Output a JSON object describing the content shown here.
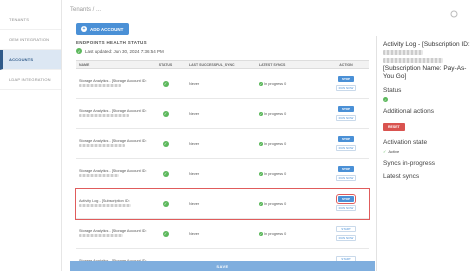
{
  "sidebar": {
    "items": [
      {
        "label": "TENANTS"
      },
      {
        "label": "OEM INTEGRATION"
      },
      {
        "label": "ACCOUNTS"
      },
      {
        "label": "LDAP INTEGRATION"
      }
    ]
  },
  "crumb": "Tenants / ...",
  "toolbar": {
    "add_account_label": "ADD ACCOUNT"
  },
  "health": {
    "title": "ENDPOINTS HEALTH STATUS",
    "last_updated": "Last updated: Jun 30, 2024 7:36:54 PM"
  },
  "table": {
    "headers": {
      "name": "NAME",
      "status": "STATUS",
      "last_sync": "LAST SUCCESSFUL_SYNC",
      "latest_syncs": "LATEST SYNCS",
      "action": "ACTION"
    },
    "rows": [
      {
        "name": "Storage Analytics - [Storage Account ID:",
        "last": "Never",
        "latest": "In progress 0",
        "stop": "STOP",
        "run": "RUN NOW"
      },
      {
        "name": "Storage Analytics - [Storage Account ID:",
        "last": "Never",
        "latest": "In progress 0",
        "stop": "STOP",
        "run": "RUN NOW"
      },
      {
        "name": "Storage Analytics - [Storage Account ID:",
        "last": "Never",
        "latest": "In progress 0",
        "stop": "STOP",
        "run": "RUN NOW"
      },
      {
        "name": "Storage Analytics - [Storage Account ID:",
        "last": "Never",
        "latest": "In progress 0",
        "stop": "STOP",
        "run": "RUN NOW"
      },
      {
        "name": "Activity Log - [Subscription ID:",
        "last": "Never",
        "latest": "In progress 0",
        "stop": "STOP",
        "run": "RUN NOW"
      },
      {
        "name": "Storage Analytics - [Storage Account ID:",
        "last": "Never",
        "latest": "In progress 0",
        "stop": "START",
        "run": "RUN NOW"
      },
      {
        "name": "Storage Analytics - [Storage Account ID:",
        "last": "Never",
        "latest": "In progress 0",
        "stop": "START",
        "run": "RUN NOW"
      }
    ]
  },
  "save_label": "SAVE",
  "panel": {
    "title": "Activity Log - [Subscription ID:",
    "title_tail": "[Subscription Name: Pay-As-You Go]",
    "status_label": "Status",
    "additional_actions_label": "Additional actions",
    "reset_label": "RESET",
    "activation_state_label": "Activation state",
    "active_value": "Active",
    "syncs_in_progress_label": "Syncs in-progress",
    "latest_syncs_label": "Latest syncs"
  },
  "colors": {
    "accent": "#4a90d6",
    "ok": "#5cb85c",
    "danger": "#d9534f",
    "highlight": "#e05c5c"
  }
}
